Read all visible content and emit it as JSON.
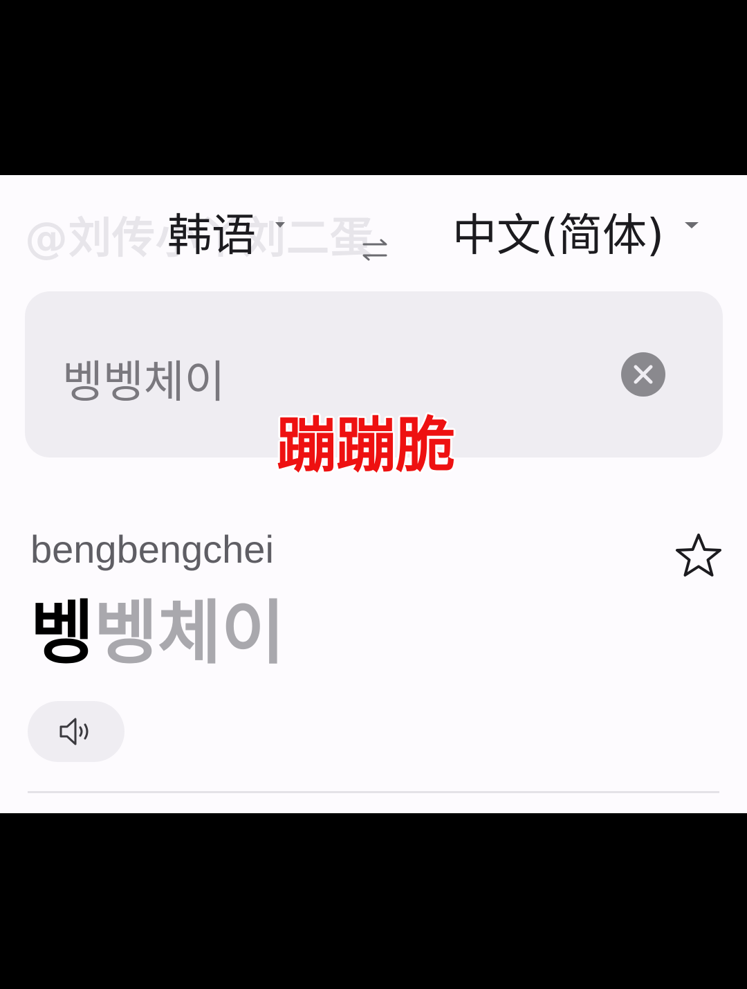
{
  "watermark": "@刘传小丫刘二蛋",
  "language_bar": {
    "source_language": "韩语",
    "target_language": "中文(简体)",
    "swap_icon": "swap-arrows-icon",
    "dropdown_icon": "caret-down-icon"
  },
  "input": {
    "text": "벵벵체이",
    "clear_icon": "clear-circle-icon"
  },
  "overlay_caption": "蹦蹦脆",
  "result": {
    "romanization": "bengbengchei",
    "highlighted": "벵",
    "remaining": "벵체이",
    "star_icon": "star-outline-icon",
    "speaker_icon": "speaker-icon"
  },
  "colors": {
    "background": "#fdfbfe",
    "card": "#efedf2",
    "caption": "#ee1111",
    "highlight": "#000000",
    "muted_result": "#a9a8ad"
  }
}
